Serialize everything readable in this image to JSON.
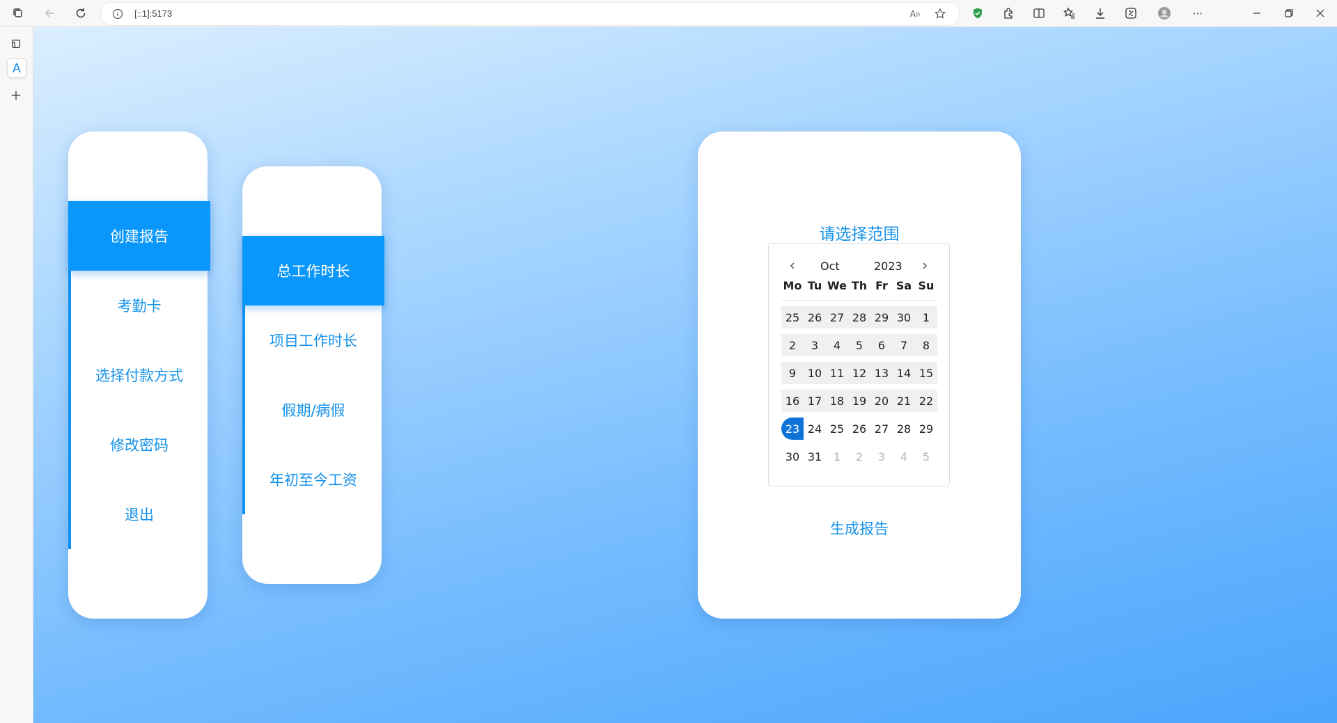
{
  "browser": {
    "url": "[::1]:5173"
  },
  "menu_main": {
    "items": [
      {
        "label": "创建报告",
        "active": true
      },
      {
        "label": "考勤卡",
        "active": false
      },
      {
        "label": "选择付款方式",
        "active": false
      },
      {
        "label": "修改密码",
        "active": false
      },
      {
        "label": "退出",
        "active": false
      }
    ]
  },
  "menu_report": {
    "items": [
      {
        "label": "总工作时长",
        "active": true
      },
      {
        "label": "项目工作时长",
        "active": false
      },
      {
        "label": "假期/病假",
        "active": false
      },
      {
        "label": "年初至今工资",
        "active": false
      }
    ]
  },
  "report": {
    "title": "请选择范围",
    "generate_label": "生成报告"
  },
  "calendar": {
    "month": "Oct",
    "year": "2023",
    "weekdays": [
      "Mo",
      "Tu",
      "We",
      "Th",
      "Fr",
      "Sa",
      "Su"
    ],
    "weeks": [
      [
        "25",
        "26",
        "27",
        "28",
        "29",
        "30",
        "1"
      ],
      [
        "2",
        "3",
        "4",
        "5",
        "6",
        "7",
        "8"
      ],
      [
        "9",
        "10",
        "11",
        "12",
        "13",
        "14",
        "15"
      ],
      [
        "16",
        "17",
        "18",
        "19",
        "20",
        "21",
        "22"
      ],
      [
        "23",
        "24",
        "25",
        "26",
        "27",
        "28",
        "29"
      ],
      [
        "30",
        "31",
        "1",
        "2",
        "3",
        "4",
        "5"
      ]
    ],
    "selected_day": "23",
    "colors": {
      "selected": "#0c73d9",
      "range": "#f0f0f0",
      "accent": "#1592ea"
    }
  }
}
